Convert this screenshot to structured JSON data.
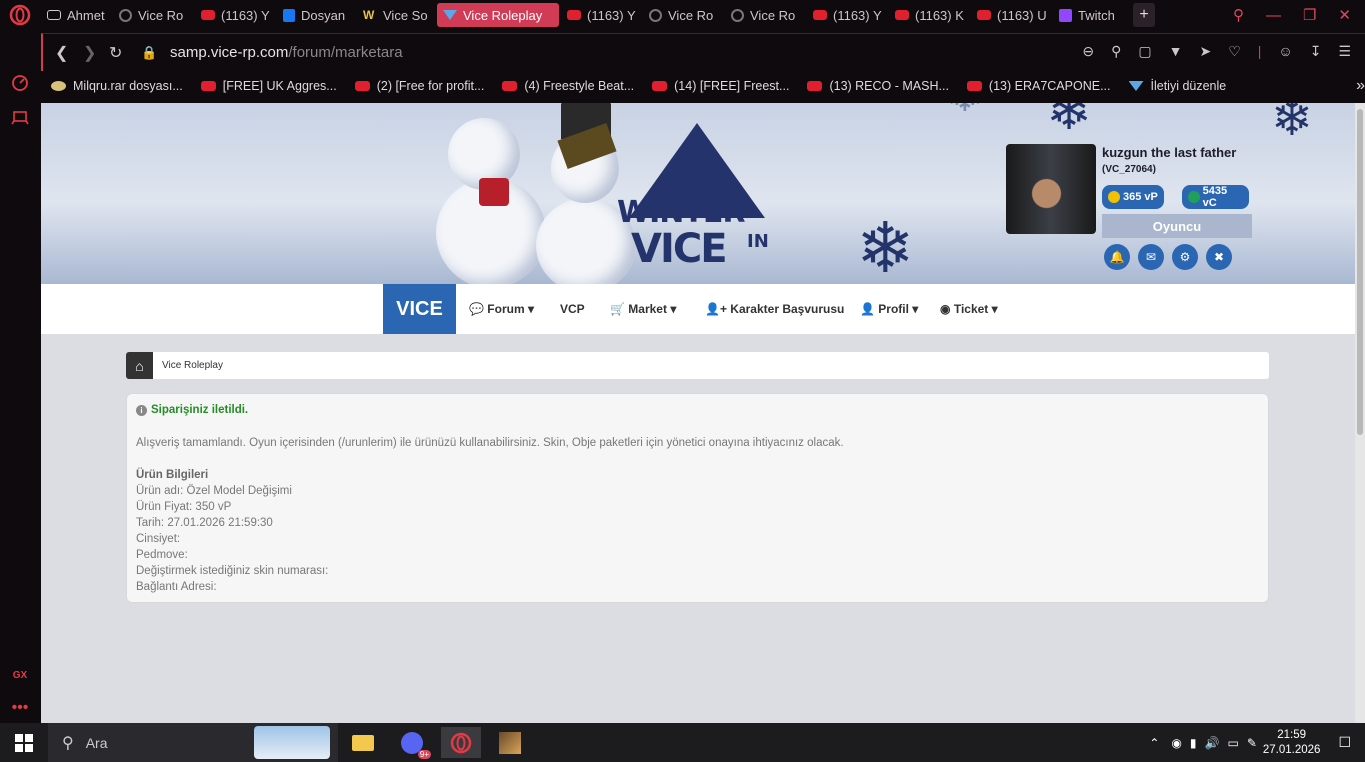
{
  "tabs": [
    {
      "label": "Ahmet",
      "icon": "gamepad-icon"
    },
    {
      "label": "Vice Ro",
      "icon": "loading-icon"
    },
    {
      "label": "(1163) Y",
      "icon": "youtube-icon"
    },
    {
      "label": "Dosyan",
      "icon": "file-icon"
    },
    {
      "label": "Vice So",
      "icon": "w-icon"
    },
    {
      "label": "Vice Roleplay",
      "icon": "vice-icon",
      "active": true
    },
    {
      "label": "(1163) Y",
      "icon": "youtube-icon"
    },
    {
      "label": "Vice Ro",
      "icon": "loading-icon"
    },
    {
      "label": "Vice Ro",
      "icon": "loading-icon"
    },
    {
      "label": "(1163) Y",
      "icon": "youtube-icon"
    },
    {
      "label": "(1163) K",
      "icon": "youtube-icon"
    },
    {
      "label": "(1163) U",
      "icon": "youtube-icon"
    },
    {
      "label": "Twitch",
      "icon": "twitch-icon"
    }
  ],
  "address": {
    "domain": "samp.vice-rp.com",
    "path": "/forum/marketara"
  },
  "bookmarks": [
    {
      "label": "Milqru.rar dosyası...",
      "icon": "file-icon"
    },
    {
      "label": "[FREE] UK Aggres...",
      "icon": "youtube-icon"
    },
    {
      "label": "(2) [Free for profit...",
      "icon": "youtube-icon"
    },
    {
      "label": "(4) Freestyle Beat...",
      "icon": "youtube-icon"
    },
    {
      "label": "(14) [FREE] Freest...",
      "icon": "youtube-icon"
    },
    {
      "label": "(13) RECO - MASH...",
      "icon": "youtube-icon"
    },
    {
      "label": "(13) ERA7CAPONE...",
      "icon": "youtube-icon"
    },
    {
      "label": "İletiyi düzenle",
      "icon": "vice-icon"
    }
  ],
  "banner": {
    "logo_line1": "WINTER",
    "logo_line2": "VICE",
    "logo_line3": "IN"
  },
  "profile": {
    "name": "kuzgun the last father",
    "id": "(VC_27064)",
    "vp": "365 vP",
    "vc": "5435 vC",
    "role": "Oyuncu"
  },
  "nav": {
    "brand": "VICE",
    "items": [
      "Forum",
      "VCP",
      "Market",
      "Karakter Başvurusu",
      "Profil",
      "Ticket"
    ]
  },
  "breadcrumb": {
    "label": "Vice Roleplay"
  },
  "order": {
    "status": "Siparişiniz iletildi.",
    "message": "Alışveriş tamamlandı. Oyun içerisinden (/urunlerim) ile ürünüzü kullanabilirsiniz. Skin, Obje paketleri için yönetici onayına ihtiyacınız olacak.",
    "heading": "Ürün Bilgileri",
    "product": "Ürün adı: Özel Model Değişimi",
    "price": "Ürün Fiyat: 350 vP",
    "date": "Tarih: 27.01.2026 21:59:30",
    "gender": "Cinsiyet:",
    "pedmove": "Pedmove:",
    "skin": "Değiştirmek istediğiniz skin numarası:",
    "link": "Bağlantı Adresi:"
  },
  "taskbar": {
    "search_placeholder": "Ara",
    "time": "21:59",
    "date": "27.01.2026",
    "discord_badge": "9+"
  },
  "colors": {
    "accent": "#d13b56",
    "brand_blue": "#2b66b3",
    "success": "#258d25"
  }
}
